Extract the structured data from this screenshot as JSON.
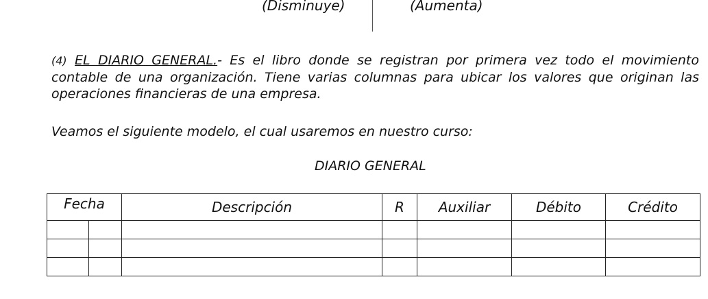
{
  "top": {
    "left_label": "(Disminuye)",
    "right_label": "(Aumenta)"
  },
  "section": {
    "number": "(4)",
    "heading": "EL DIARIO GENERAL.",
    "text": "- Es el libro donde se registran por primera vez todo el movimiento contable de una organización. Tiene varias columnas para ubicar los valores que originan las operaciones financieras de una empresa."
  },
  "model_sentence": "Veamos el siguiente modelo, el cual usaremos en nuestro curso:",
  "journal": {
    "title": "DIARIO GENERAL",
    "columns": {
      "fecha": "Fecha",
      "descripcion": "Descripción",
      "r": "R",
      "auxiliar": "Auxiliar",
      "debito": "Débito",
      "credito": "Crédito"
    },
    "empty_rows": 3
  }
}
